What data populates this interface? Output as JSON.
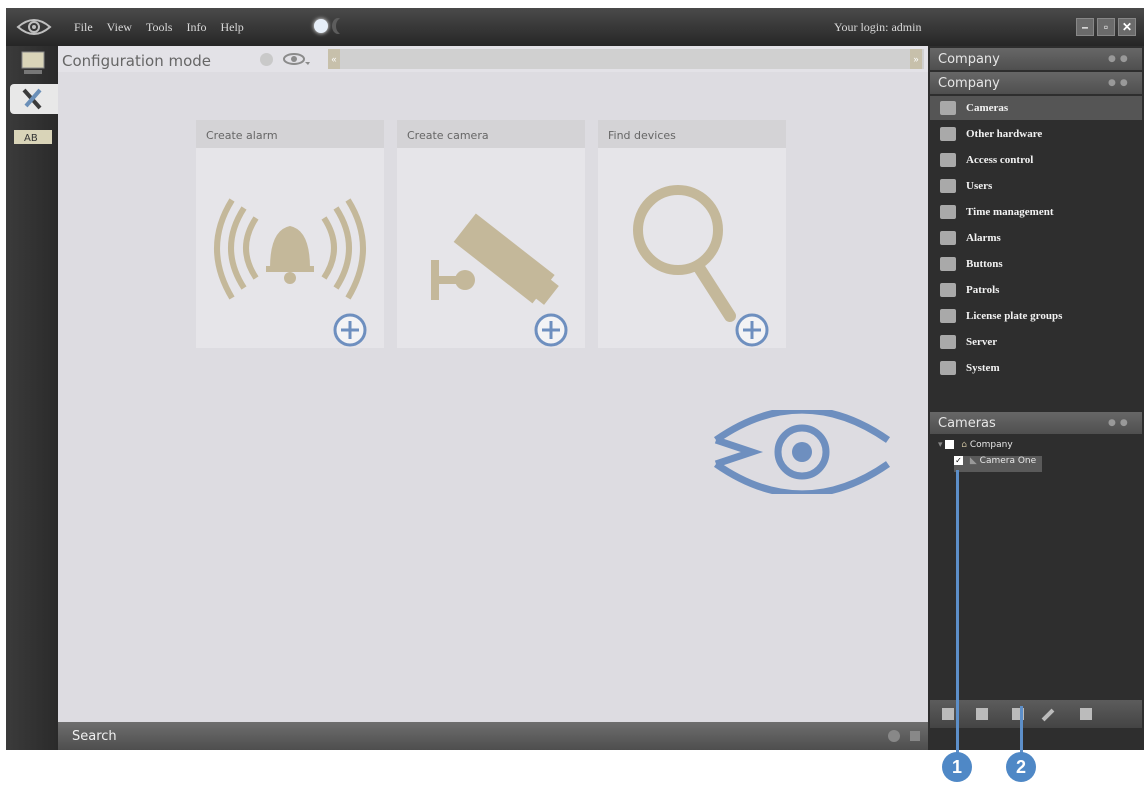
{
  "menu": {
    "items": [
      "File",
      "View",
      "Tools",
      "Info",
      "Help"
    ]
  },
  "header": {
    "login": "Your login: admin"
  },
  "main": {
    "title": "Configuration mode",
    "tiles": [
      {
        "label": "Create alarm",
        "icon": "alarm-bell-icon"
      },
      {
        "label": "Create camera",
        "icon": "security-camera-icon"
      },
      {
        "label": "Find devices",
        "icon": "magnifier-icon"
      }
    ],
    "search_label": "Search"
  },
  "right_panel": {
    "top_title": "Company",
    "tree_title": "Company",
    "nav_items": [
      {
        "label": "Cameras",
        "icon": "camera-icon",
        "selected": true
      },
      {
        "label": "Other hardware",
        "icon": "hardware-icon"
      },
      {
        "label": "Access control",
        "icon": "access-control-icon"
      },
      {
        "label": "Users",
        "icon": "user-icon"
      },
      {
        "label": "Time management",
        "icon": "clock-icon"
      },
      {
        "label": "Alarms",
        "icon": "alarm-icon"
      },
      {
        "label": "Buttons",
        "icon": "button-icon"
      },
      {
        "label": "Patrols",
        "icon": "patrol-icon"
      },
      {
        "label": "License plate groups",
        "icon": "license-plate-icon"
      },
      {
        "label": "Server",
        "icon": "server-icon"
      },
      {
        "label": "System",
        "icon": "gears-icon"
      }
    ],
    "cameras_title": "Cameras",
    "tree": {
      "root": "Company",
      "child": "Camera One"
    }
  },
  "callouts": [
    "1",
    "2"
  ],
  "colors": {
    "accent": "#4f88c6",
    "tile_icon": "#c4b89a",
    "plus": "#6e8fbf"
  }
}
